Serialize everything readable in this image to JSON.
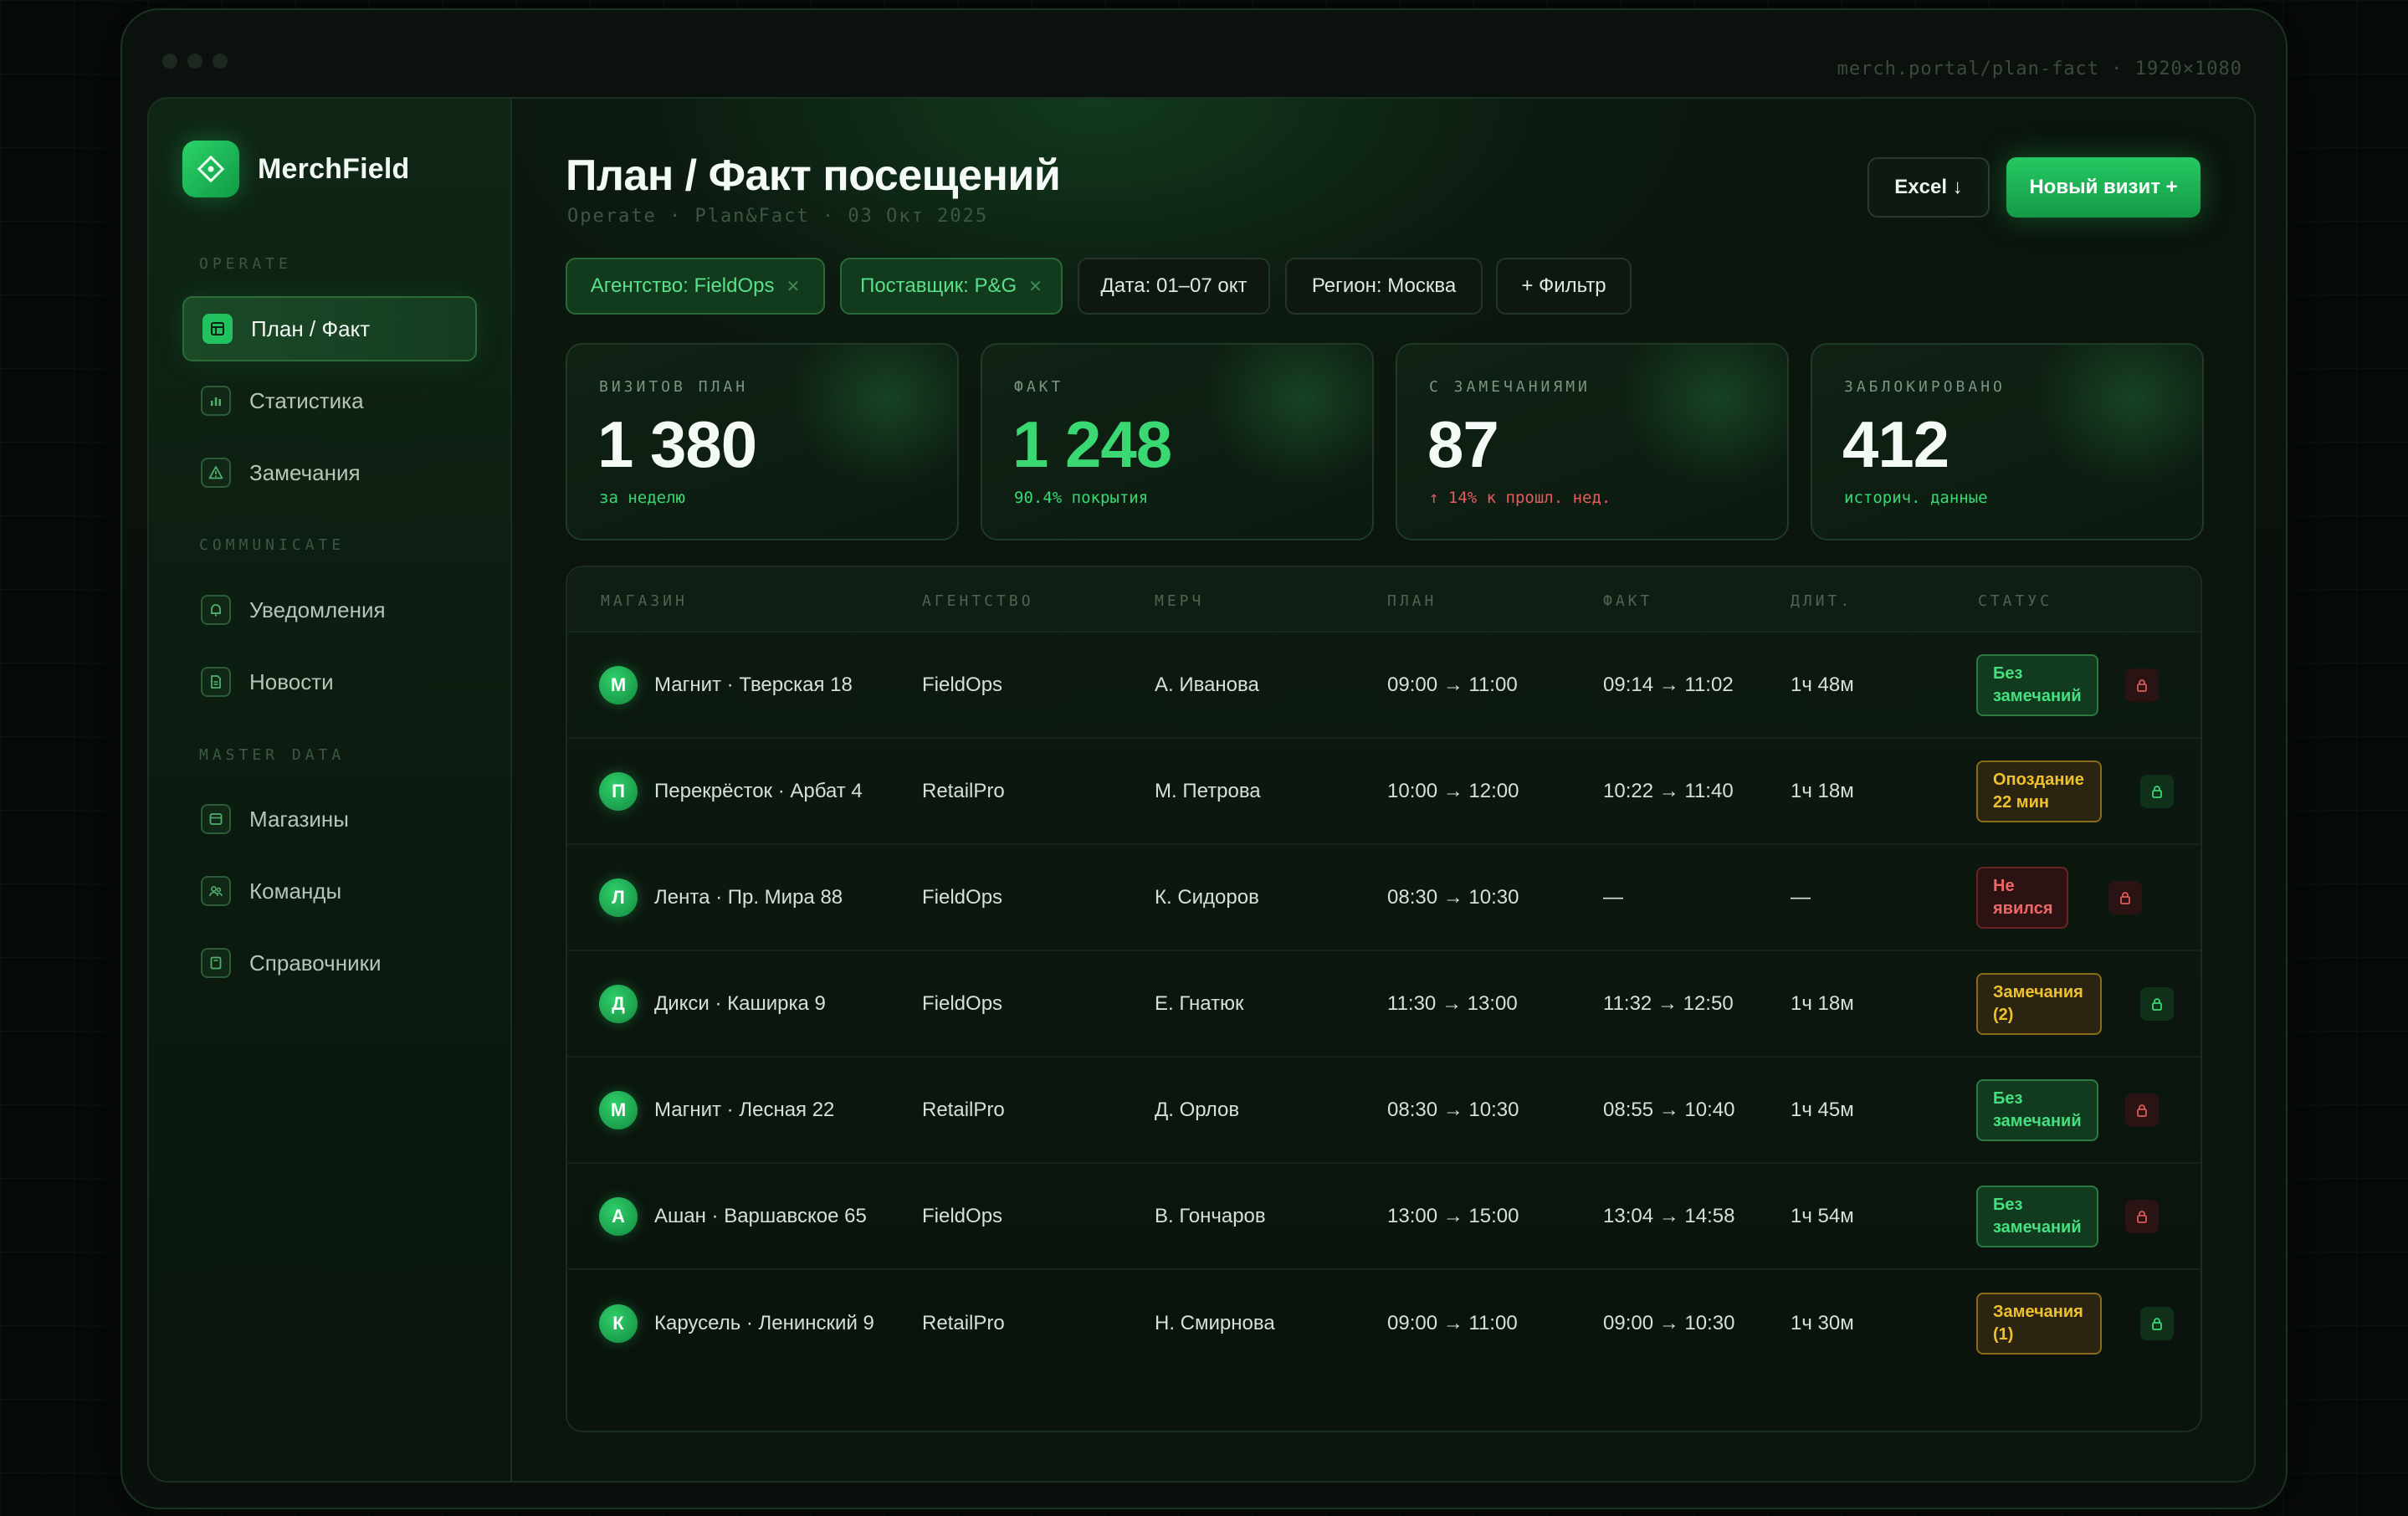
{
  "window": {
    "url": "merch.portal/plan-fact · 1920×1080"
  },
  "brand": {
    "name": "MerchField"
  },
  "sidebar": {
    "sections": [
      {
        "title": "OPERATE",
        "items": [
          {
            "label": "План / Факт",
            "active": true,
            "icon": "table-icon"
          },
          {
            "label": "Статистика",
            "icon": "bar-chart-icon"
          },
          {
            "label": "Замечания",
            "icon": "warning-icon"
          }
        ]
      },
      {
        "title": "COMMUNICATE",
        "items": [
          {
            "label": "Уведомления",
            "icon": "bell-icon"
          },
          {
            "label": "Новости",
            "icon": "document-icon"
          }
        ]
      },
      {
        "title": "MASTER DATA",
        "items": [
          {
            "label": "Магазины",
            "icon": "store-icon"
          },
          {
            "label": "Команды",
            "icon": "users-icon"
          },
          {
            "label": "Справочники",
            "icon": "book-icon"
          }
        ]
      }
    ]
  },
  "header": {
    "title": "План / Факт посещений",
    "subtitle": "Operate · Plan&Fact · 03 Окт 2025",
    "excel_label": "Excel ↓",
    "new_visit_label": "Новый визит +"
  },
  "filters": [
    {
      "label": "Агентство: FieldOps",
      "active": true,
      "removable": true
    },
    {
      "label": "Поставщик: P&G",
      "active": true,
      "removable": true
    },
    {
      "label": "Дата: 01–07 окт",
      "active": false
    },
    {
      "label": "Регион: Москва",
      "active": false
    },
    {
      "label": "+ Фильтр",
      "active": false
    }
  ],
  "stats": [
    {
      "label": "ВИЗИТОВ ПЛАН",
      "value": "1 380",
      "note": "за неделю",
      "value_color": "white",
      "note_color": "green"
    },
    {
      "label": "ФАКТ",
      "value": "1 248",
      "note": "90.4% покрытия",
      "value_color": "green",
      "note_color": "green"
    },
    {
      "label": "С ЗАМЕЧАНИЯМИ",
      "value": "87",
      "note": "↑ 14% к прошл. нед.",
      "value_color": "white",
      "note_color": "red"
    },
    {
      "label": "ЗАБЛОКИРОВАНО",
      "value": "412",
      "note": "историч. данные",
      "value_color": "white",
      "note_color": "green"
    }
  ],
  "table": {
    "columns": [
      "МАГАЗИН",
      "АГЕНТСТВО",
      "МЕРЧ",
      "ПЛАН",
      "ФАКТ",
      "ДЛИТ.",
      "СТАТУС"
    ],
    "rows": [
      {
        "initial": "М",
        "store": "Магнит · Тверская 18",
        "agency": "FieldOps",
        "merch": "А. Иванова",
        "plan": "09:00 → 11:00",
        "fact": "09:14 → 11:02",
        "duration": "1ч 48м",
        "status": "Без замечаний",
        "status_type": "ok",
        "lock": "red"
      },
      {
        "initial": "П",
        "store": "Перекрёсток · Арбат 4",
        "agency": "RetailPro",
        "merch": "М. Петрова",
        "plan": "10:00 → 12:00",
        "fact": "10:22 → 11:40",
        "duration": "1ч 18м",
        "status": "Опоздание 22 мин",
        "status_type": "warn",
        "lock": "green"
      },
      {
        "initial": "Л",
        "store": "Лента · Пр. Мира 88",
        "agency": "FieldOps",
        "merch": "К. Сидоров",
        "plan": "08:30 → 10:30",
        "fact": "—",
        "duration": "—",
        "status": "Не явился",
        "status_type": "bad",
        "lock": "red"
      },
      {
        "initial": "Д",
        "store": "Дикси · Каширка 9",
        "agency": "FieldOps",
        "merch": "Е. Гнатюк",
        "plan": "11:30 → 13:00",
        "fact": "11:32 → 12:50",
        "duration": "1ч 18м",
        "status": "Замечания (2)",
        "status_type": "warn",
        "lock": "green"
      },
      {
        "initial": "М",
        "store": "Магнит · Лесная 22",
        "agency": "RetailPro",
        "merch": "Д. Орлов",
        "plan": "08:30 → 10:30",
        "fact": "08:55 → 10:40",
        "duration": "1ч 45м",
        "status": "Без замечаний",
        "status_type": "ok",
        "lock": "red"
      },
      {
        "initial": "А",
        "store": "Ашан · Варшавское 65",
        "agency": "FieldOps",
        "merch": "В. Гончаров",
        "plan": "13:00 → 15:00",
        "fact": "13:04 → 14:58",
        "duration": "1ч 54м",
        "status": "Без замечаний",
        "status_type": "ok",
        "lock": "red"
      },
      {
        "initial": "К",
        "store": "Карусель · Ленинский 9",
        "agency": "RetailPro",
        "merch": "Н. Смирнова",
        "plan": "09:00 → 11:00",
        "fact": "09:00 → 10:30",
        "duration": "1ч 30м",
        "status": "Замечания (1)",
        "status_type": "warn",
        "lock": "green"
      }
    ]
  },
  "colors": {
    "accent": "#22c35f",
    "ok": "#45e07f",
    "warn": "#f0c12e",
    "bad": "#f06767",
    "background": "#070b08"
  }
}
